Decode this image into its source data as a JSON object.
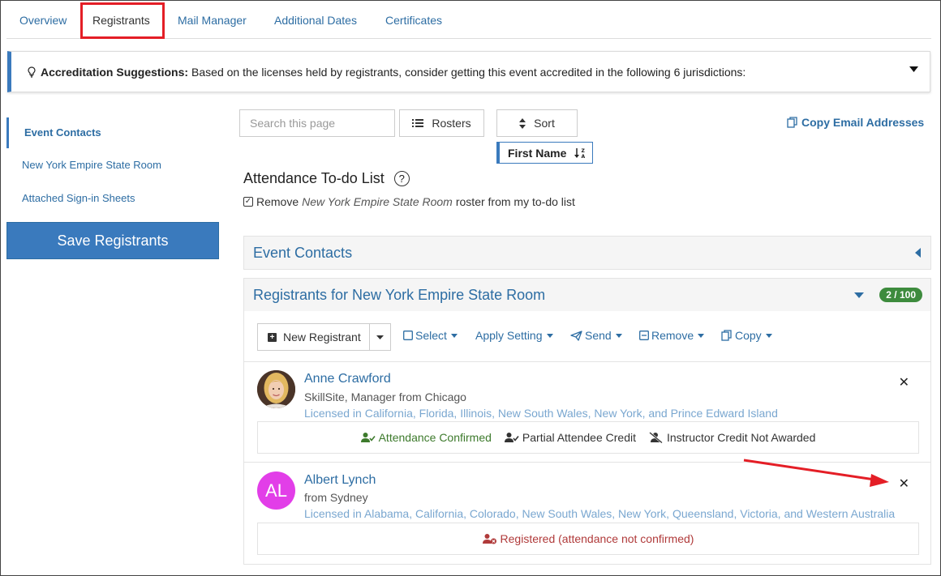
{
  "tabs": [
    {
      "label": "Overview"
    },
    {
      "label": "Registrants"
    },
    {
      "label": "Mail Manager"
    },
    {
      "label": "Additional Dates"
    },
    {
      "label": "Certificates"
    }
  ],
  "alert": {
    "title": "Accreditation Suggestions:",
    "text": "Based on the licenses held by registrants, consider getting this event accredited in the following 6 jurisdictions:"
  },
  "sidebar": {
    "items": [
      {
        "label": "Event Contacts"
      },
      {
        "label": "New York Empire State Room"
      },
      {
        "label": "Attached Sign-in Sheets"
      }
    ],
    "save_label": "Save Registrants"
  },
  "toolbar": {
    "search_placeholder": "Search this page",
    "rosters_label": "Rosters",
    "sort_label": "Sort",
    "sort_field": "First Name",
    "copy_emails_label": "Copy Email Addresses"
  },
  "todo": {
    "title": "Attendance To-do List",
    "check_prefix": "Remove ",
    "check_room": "New York Empire State Room",
    "check_suffix": " roster from my to-do list"
  },
  "panels": {
    "contacts_title": "Event Contacts",
    "registrants_title": "Registrants for New York Empire State Room",
    "badge": "2 / 100"
  },
  "actions": {
    "new_registrant": "New Registrant",
    "select": "Select",
    "apply_setting": "Apply Setting",
    "send": "Send",
    "remove": "Remove",
    "copy": "Copy"
  },
  "registrants": [
    {
      "name": "Anne Crawford",
      "subtitle": "SkillSite, Manager from Chicago",
      "licenses_prefix": "Licensed in ",
      "licenses": "California, Florida, Illinois, New South Wales, New York, and Prince Edward Island",
      "statuses": [
        {
          "label": "Attendance Confirmed"
        },
        {
          "label": "Partial Attendee Credit"
        },
        {
          "label": "Instructor Credit Not Awarded"
        }
      ]
    },
    {
      "name": "Albert Lynch",
      "initials": "AL",
      "subtitle": "from Sydney",
      "licenses_prefix": "Licensed in ",
      "licenses": "Alabama, California, Colorado, New South Wales, New York, Queensland, Victoria, and Western Australia",
      "statuses": [
        {
          "label": "Registered (attendance not confirmed)"
        }
      ]
    }
  ],
  "colors": {
    "accent": "#3a7abd",
    "link": "#2d6da3",
    "license": "#7aa7d0",
    "success": "#3d7a2c",
    "danger": "#b03a3a",
    "badge": "#3d8b3d",
    "annotation_red": "#e41e26",
    "avatar_magenta": "#e23ee8"
  }
}
